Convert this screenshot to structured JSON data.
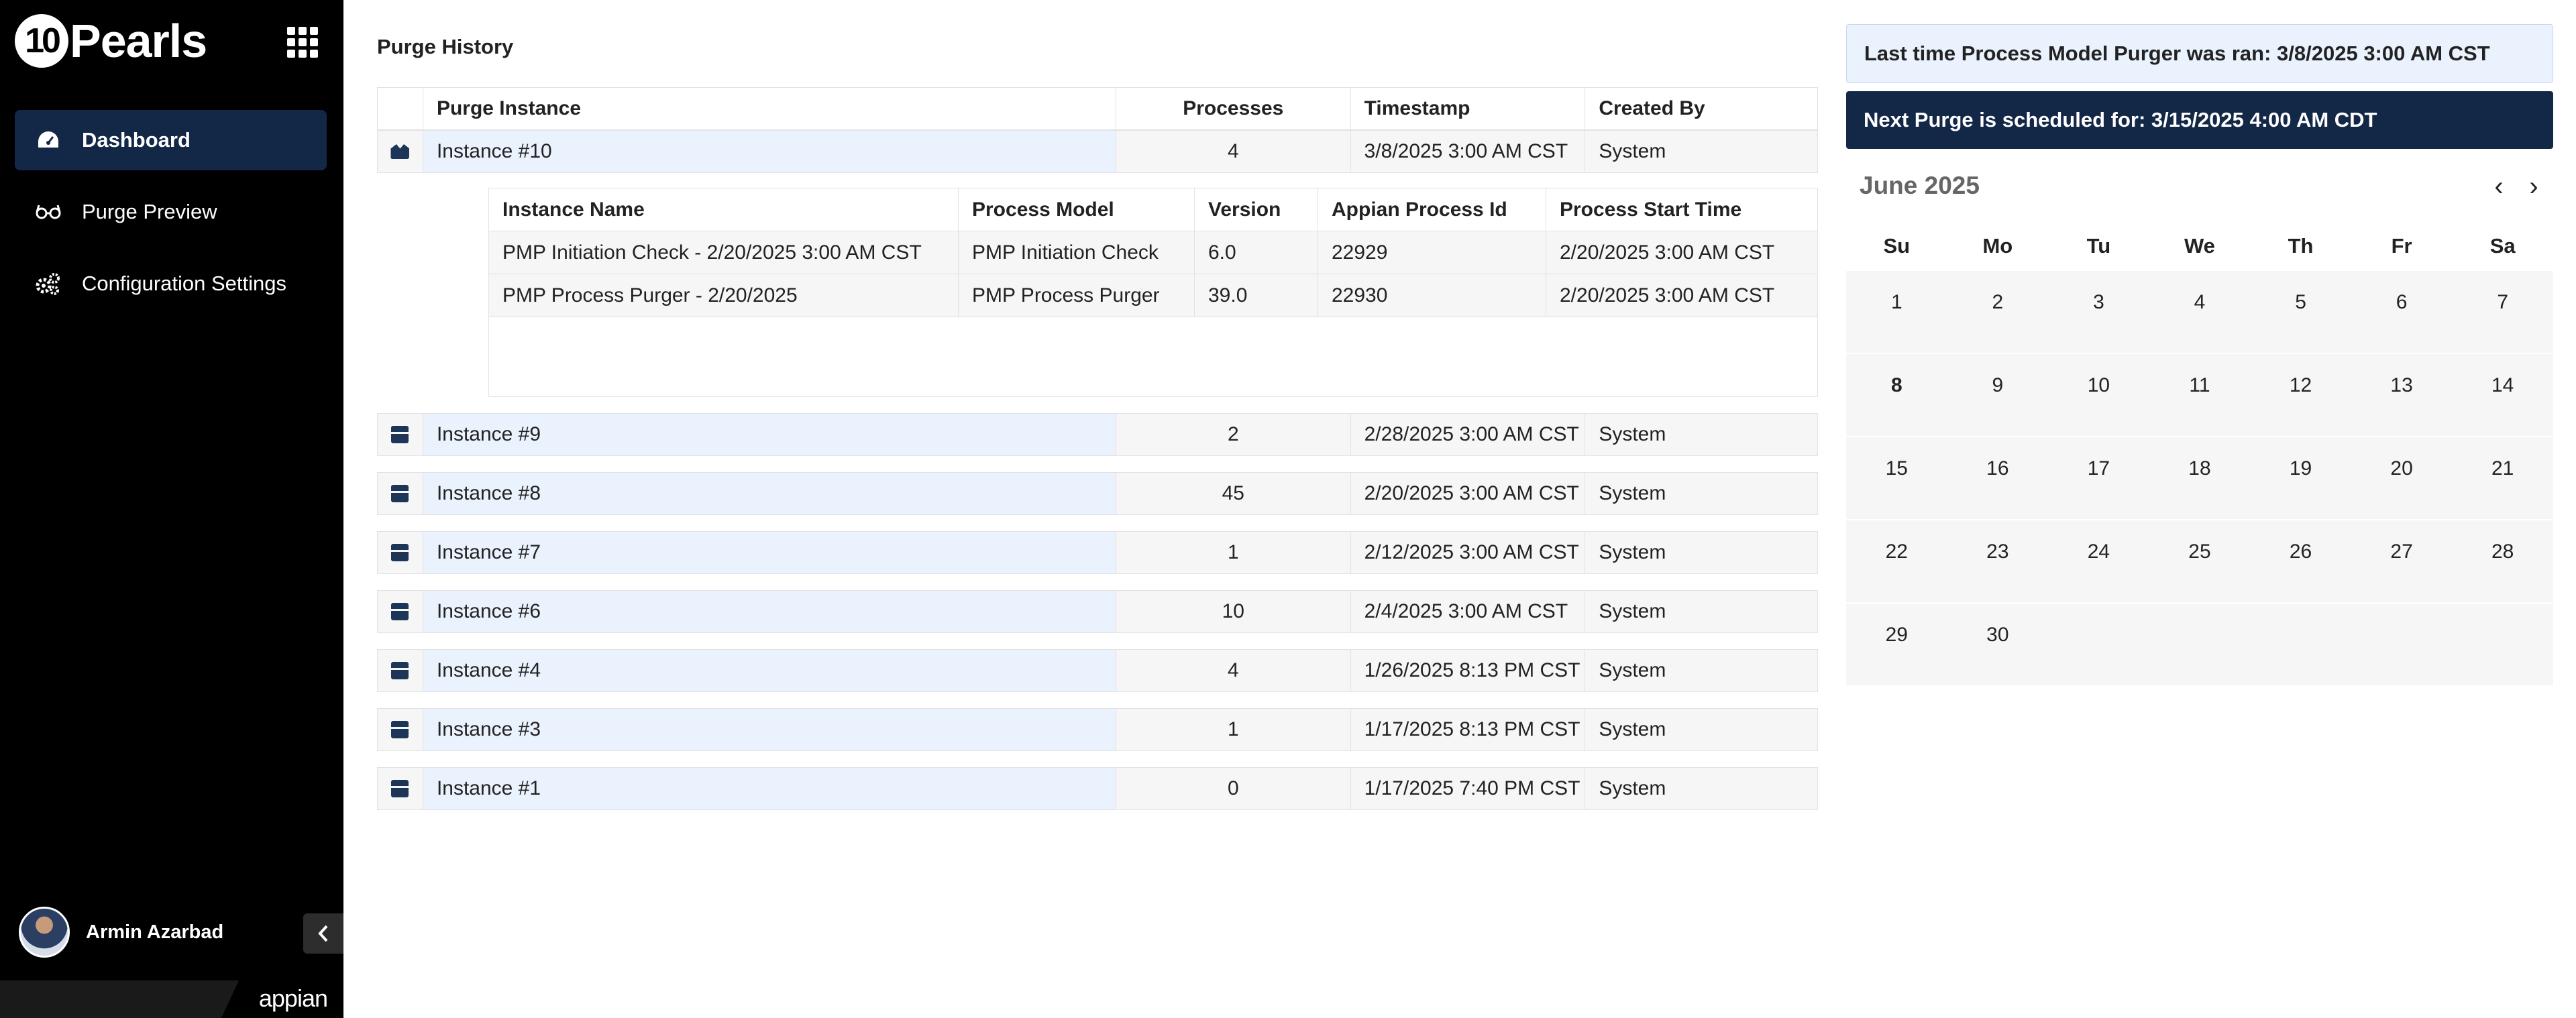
{
  "sidebar": {
    "logo": {
      "mark": "10",
      "text": "Pearls"
    },
    "apps_icon": "apps-grid-icon",
    "nav": [
      {
        "label": "Dashboard",
        "icon": "dashboard-gauge-icon",
        "active": true
      },
      {
        "label": "Purge Preview",
        "icon": "glasses-icon",
        "active": false
      },
      {
        "label": "Configuration Settings",
        "icon": "gears-icon",
        "active": false
      }
    ],
    "user": {
      "name": "Armin Azarbad"
    },
    "collapse_icon": "chevron-left-icon",
    "brand": "appian"
  },
  "main": {
    "title": "Purge History",
    "columns": [
      "Purge Instance",
      "Processes",
      "Timestamp",
      "Created By"
    ],
    "rows": [
      {
        "instance": "Instance #10",
        "processes": "4",
        "timestamp": "3/8/2025 3:00 AM CST",
        "created_by": "System",
        "expanded": true
      },
      {
        "instance": "Instance #9",
        "processes": "2",
        "timestamp": "2/28/2025 3:00 AM CST",
        "created_by": "System"
      },
      {
        "instance": "Instance #8",
        "processes": "45",
        "timestamp": "2/20/2025 3:00 AM CST",
        "created_by": "System"
      },
      {
        "instance": "Instance #7",
        "processes": "1",
        "timestamp": "2/12/2025 3:00 AM CST",
        "created_by": "System"
      },
      {
        "instance": "Instance #6",
        "processes": "10",
        "timestamp": "2/4/2025 3:00 AM CST",
        "created_by": "System"
      },
      {
        "instance": "Instance #4",
        "processes": "4",
        "timestamp": "1/26/2025 8:13 PM CST",
        "created_by": "System"
      },
      {
        "instance": "Instance #3",
        "processes": "1",
        "timestamp": "1/17/2025 8:13 PM CST",
        "created_by": "System"
      },
      {
        "instance": "Instance #1",
        "processes": "0",
        "timestamp": "1/17/2025 7:40 PM CST",
        "created_by": "System"
      }
    ],
    "detail": {
      "columns": [
        "Instance Name",
        "Process Model",
        "Version",
        "Appian Process Id",
        "Process Start Time"
      ],
      "rows": [
        [
          "PMP Initiation Check - 2/20/2025 3:00 AM CST",
          "PMP Initiation Check",
          "6.0",
          "22929",
          "2/20/2025 3:00 AM CST"
        ],
        [
          "PMP Process Purger - 2/20/2025",
          "PMP Process Purger",
          "39.0",
          "22930",
          "2/20/2025 3:00 AM CST"
        ]
      ]
    }
  },
  "right": {
    "last_run": "Last time Process Model Purger was ran: 3/8/2025 3:00 AM CST",
    "next_purge": "Next Purge is scheduled for: 3/15/2025 4:00 AM CDT",
    "calendar": {
      "title": "June 2025",
      "prev": "‹",
      "next": "›",
      "weekdays": [
        "Su",
        "Mo",
        "Tu",
        "We",
        "Th",
        "Fr",
        "Sa"
      ],
      "weeks": [
        [
          "1",
          "2",
          "3",
          "4",
          "5",
          "6",
          "7"
        ],
        [
          "8",
          "9",
          "10",
          "11",
          "12",
          "13",
          "14"
        ],
        [
          "15",
          "16",
          "17",
          "18",
          "19",
          "20",
          "21"
        ],
        [
          "22",
          "23",
          "24",
          "25",
          "26",
          "27",
          "28"
        ],
        [
          "29",
          "30",
          "",
          "",
          "",
          "",
          ""
        ]
      ],
      "today": "8"
    }
  }
}
